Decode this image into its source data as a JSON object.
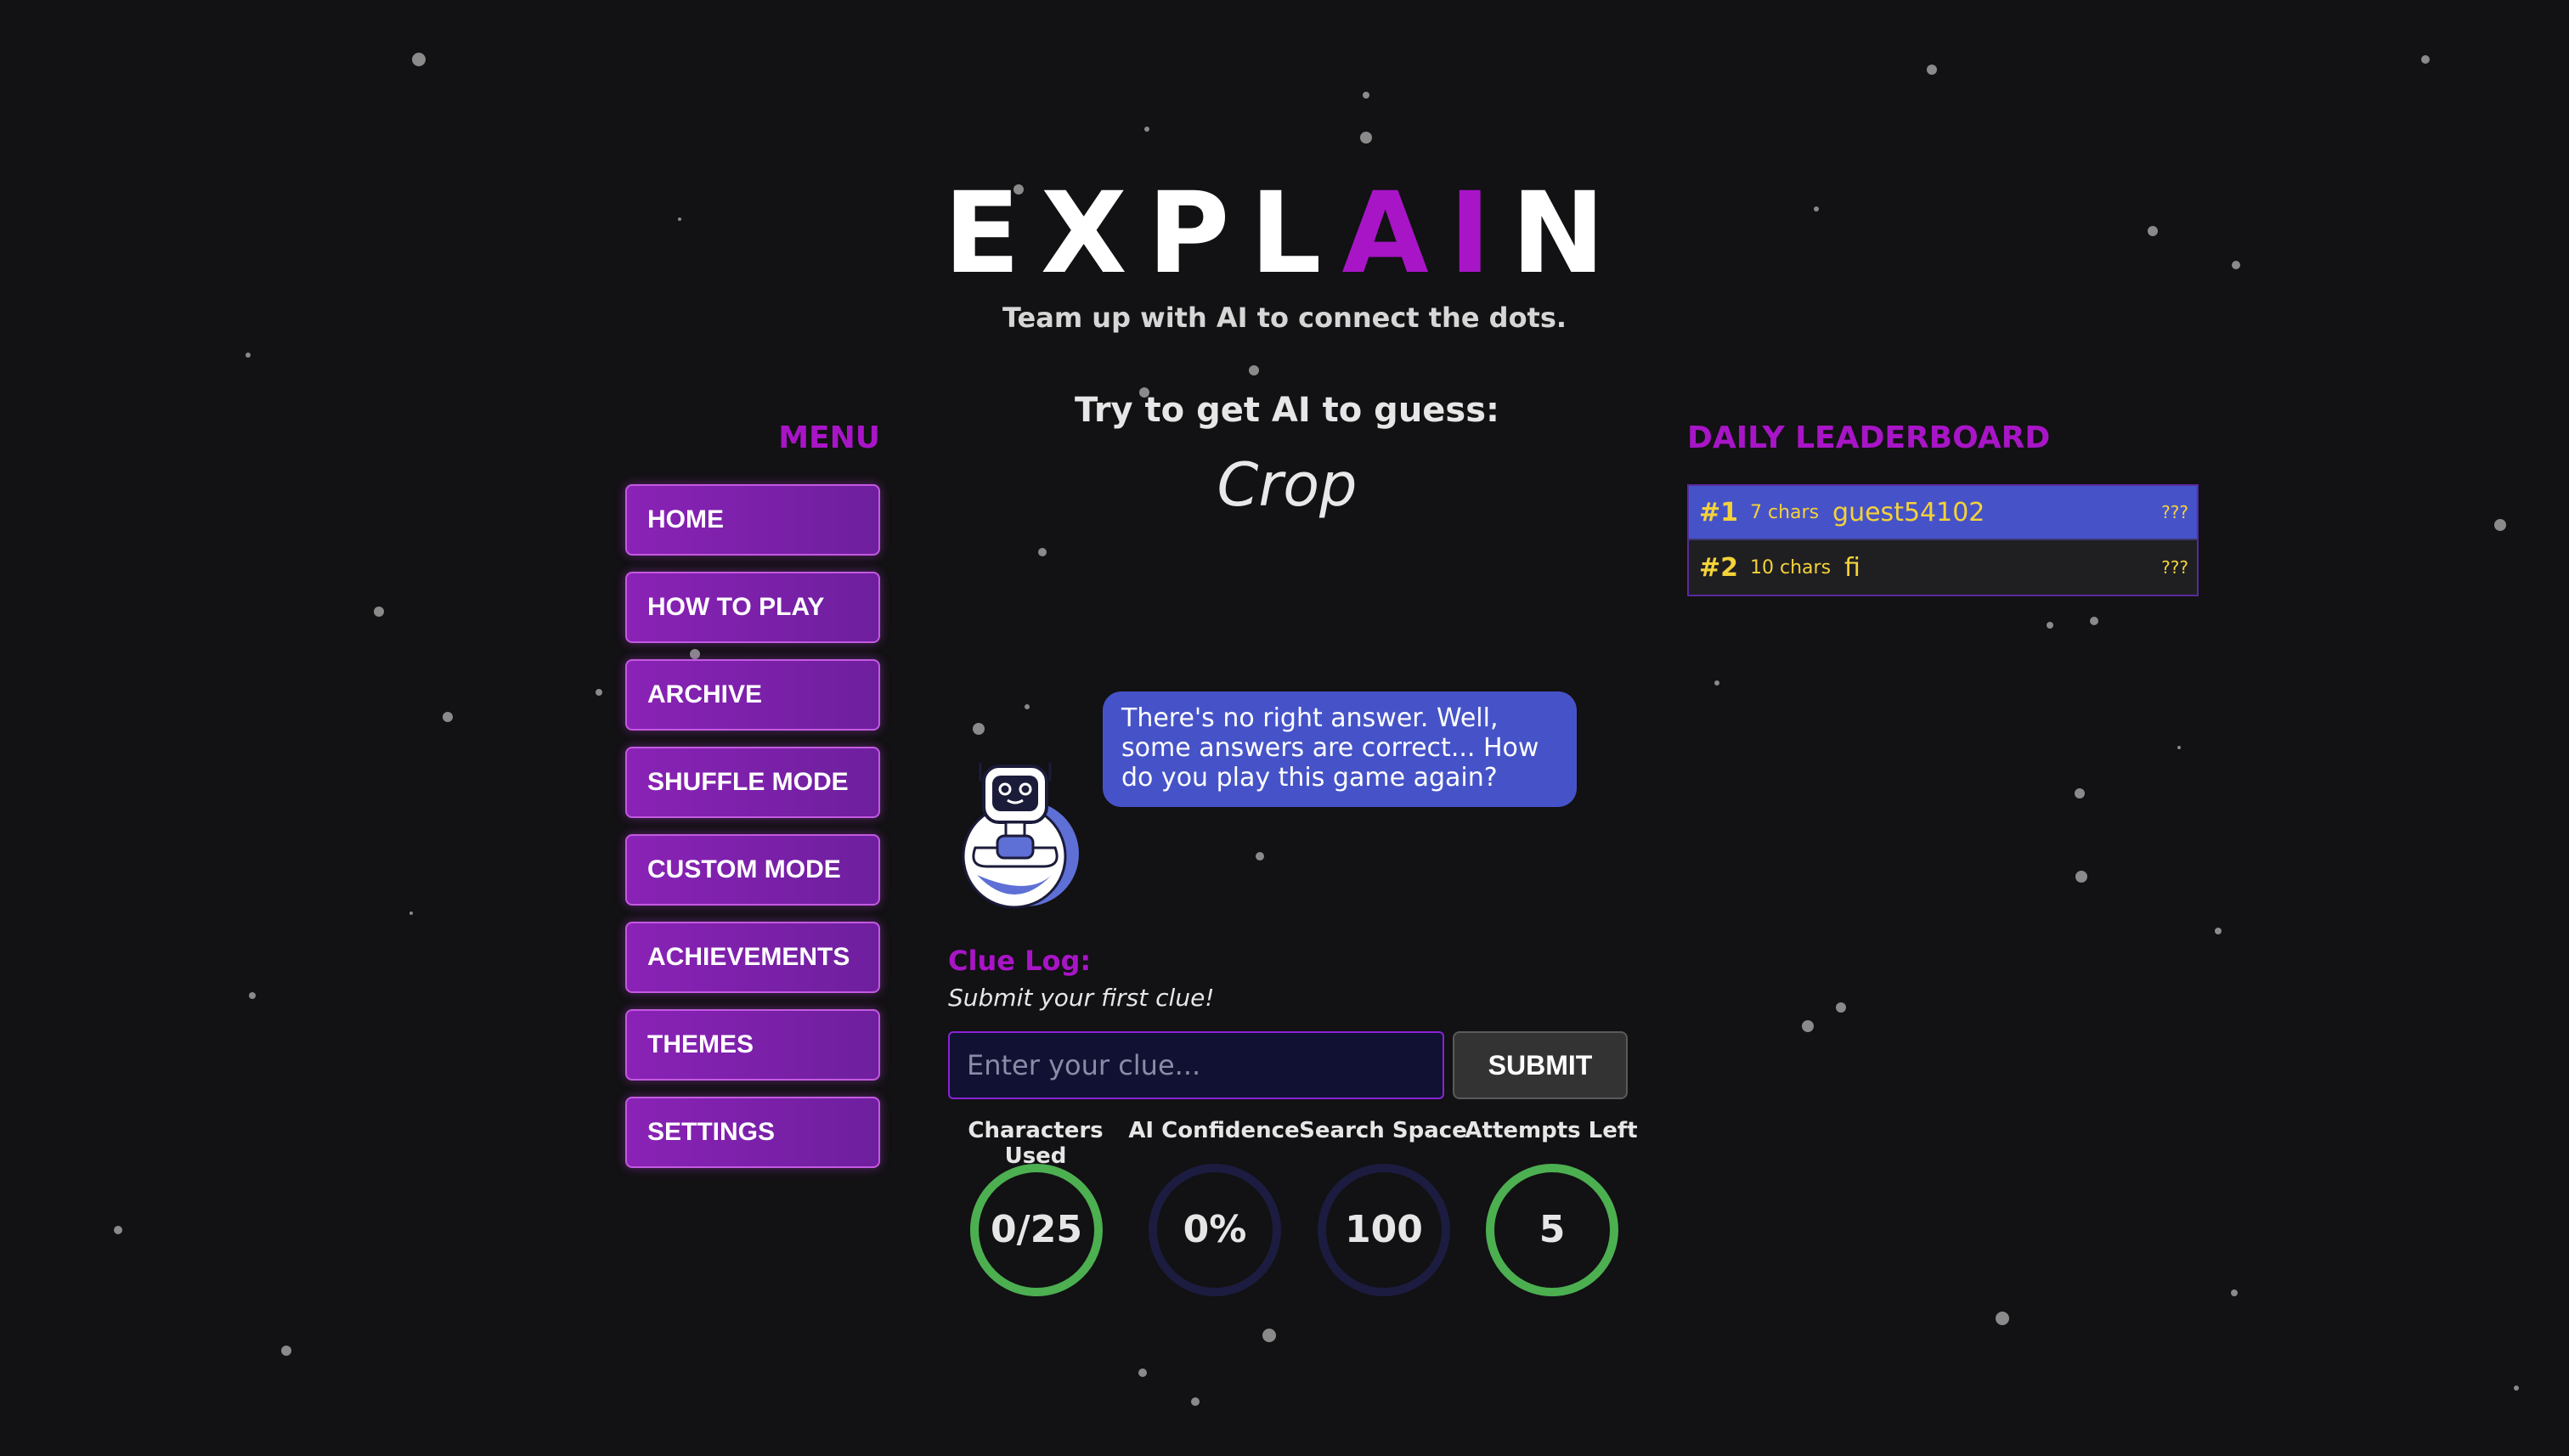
{
  "header": {
    "logo_main": "EXPL",
    "logo_accent": "AI",
    "logo_end": "N",
    "tagline": "Team up with AI to connect the dots."
  },
  "menu": {
    "title": "MENU",
    "items": [
      {
        "label": "HOME"
      },
      {
        "label": "HOW TO PLAY"
      },
      {
        "label": "ARCHIVE"
      },
      {
        "label": "SHUFFLE MODE"
      },
      {
        "label": "CUSTOM MODE"
      },
      {
        "label": "ACHIEVEMENTS"
      },
      {
        "label": "THEMES"
      },
      {
        "label": "SETTINGS"
      }
    ]
  },
  "game": {
    "prompt": "Try to get AI to guess:",
    "target_word": "Crop",
    "ai_message": "There's no right answer. Well, some answers are correct... How do you play this game again?",
    "clue_log_title": "Clue Log:",
    "clue_log_empty": "Submit your first clue!",
    "clue_input_placeholder": "Enter your clue...",
    "submit_label": "SUBMIT",
    "stats": [
      {
        "label": "Characters Used",
        "value": "0/25",
        "ring_fill": 1.0
      },
      {
        "label": "AI Confidence",
        "value": "0%",
        "ring_fill": 0.0
      },
      {
        "label": "Search Space",
        "value": "100",
        "ring_fill": 0.0
      },
      {
        "label": "Attempts Left",
        "value": "5",
        "ring_fill": 1.0
      }
    ]
  },
  "leaderboard": {
    "title": "DAILY LEADERBOARD",
    "entries": [
      {
        "rank": "#1",
        "chars": "7 chars",
        "name": "guest54102",
        "score": "???"
      },
      {
        "rank": "#2",
        "chars": "10 chars",
        "name": "fi",
        "score": "???"
      }
    ]
  },
  "colors": {
    "background": "#121113",
    "accent_purple": "#a815c7",
    "bubble_blue": "#4653c8",
    "ring_green": "#4caf50",
    "ring_dark": "#1c1c40",
    "leaderboard_text": "#f4d23a"
  }
}
